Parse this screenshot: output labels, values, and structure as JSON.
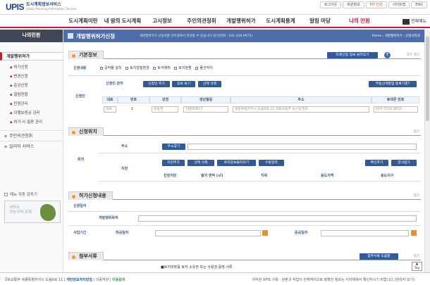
{
  "brand": {
    "mark": "UPIS",
    "name": "도시계획정보서비스",
    "sub": "Urban Planning Information Service"
  },
  "utils": [
    "로그아웃",
    "회원정보",
    "MY 민원",
    "사이트맵",
    "ENG"
  ],
  "gnb": {
    "items": [
      "도시계획이란",
      "내 땅의 도시계획",
      "고시정보",
      "주민의견청취",
      "개발행위허가",
      "도시계획통계",
      "알림 마당",
      "나의 민원"
    ],
    "active_index": 7,
    "all_menu": "전체메뉴"
  },
  "side": {
    "title": "나의민원",
    "group": "개발행위허가",
    "subs": [
      "허가신청",
      "변경신청",
      "준공신청",
      "열람현황",
      "민원관리",
      "이행보증금 관리",
      "허가·사·필증 관리"
    ],
    "mains": [
      "주민의견청취",
      "알리미 서비스"
    ],
    "auto_login": "메뉴 자동 감추기",
    "banner": "서비스\n가능지역 조회"
  },
  "header": {
    "title": "개발행위허가신청",
    "subtitle": "개발행위허가 신청서를 인터넷에서 작성할 수 있습니다.(문의전화 : 031-426-9973)",
    "breadcrumb": "Home › 개발행위허가 › 신청서작성"
  },
  "basic": {
    "label": "기본정보",
    "load_btn": "미제신청 정보 불러오기",
    "fold": "모두 접기",
    "type_label": "신청내용",
    "types": [
      "공작물 설치",
      "토지형질변경",
      "토석채취",
      "토지분할",
      "물건적치"
    ],
    "applicant_label": "신청인",
    "mgmt_label": "신청인 관리",
    "add_btn": "신청인 추가",
    "view_btn": "정보 보기",
    "del_btn": "선택 삭제",
    "real_btn": "부동산개발업 등록기준?",
    "cols": [
      "대표",
      "번호",
      "성명",
      "생년월일",
      "주소",
      "휴대폰 번호"
    ],
    "row": {
      "rep": "대표",
      "num": "1",
      "name": "윤동영",
      "birth": "19690827",
      "addr": "세종특별자치시 도움6로 11 국토교통부 도시정책과",
      "phone": "010-7320-8832"
    }
  },
  "site": {
    "label": "신청위치",
    "fold": "접기",
    "pos_label": "위치",
    "addr_label": "주소",
    "search_btn": "주소찾기",
    "parcel_label": "지번",
    "btns": [
      "지번추가",
      "선택 삭제",
      "토지정보불러오기",
      "수동입력"
    ],
    "right_btns": [
      "확인추가",
      "양식받기"
    ],
    "cols": [
      "선정지번",
      "필지 면적 (㎡)",
      "지목",
      "용도지역",
      "용도지구"
    ]
  },
  "permit": {
    "label": "허가신청내용",
    "fold": "접기",
    "sub_label": "신청일자",
    "purpose_label": "개발행위목적",
    "period_label": "사업기간",
    "start_label": "착공일자",
    "end_label": "준공일자"
  },
  "docs": {
    "label": "첨부서류",
    "fold": "접기",
    "btn": "첨부서류 도움말",
    "note": "■토지대장등 토지 소유권 또는 사용권 증명 서류"
  },
  "footer": {
    "left1": "국토교통부 세종특별자치시 도움6로 11 |",
    "left2": "개인정보처리방침",
    "left3": "| 이용약관 |",
    "left4": "이용문의",
    "right": "저작권 UPIS 구축 · 원본과 작업이 전체적이므로 정확한 정보는 지자체에서 확인하시기 바랍니다.(관리자 보기)"
  },
  "top_btn": "Top"
}
